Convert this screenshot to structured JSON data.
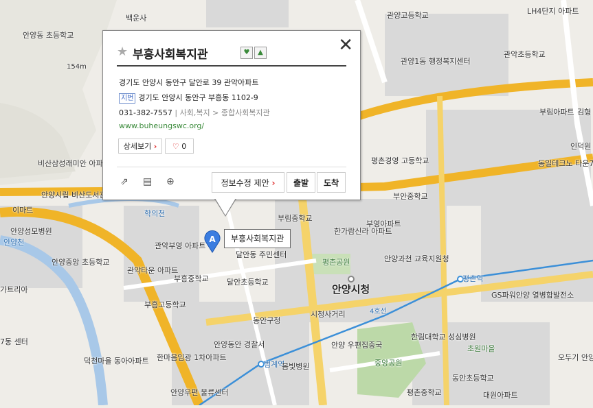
{
  "popup": {
    "title": "부흥사회복지관",
    "road_address": "경기도 안양시 동안구 달안로 39 관악아파트",
    "jibun_tag": "지번",
    "jibun_address": "경기도 안양시 동안구 부흥동 1102-9",
    "phone": "031-382-7557",
    "category": "사회,복지 > 종합사회복지관",
    "website": "www.buheungswc.org/",
    "detail_button": "상세보기",
    "like_count": "0",
    "edit_button": "정보수정 제안",
    "depart_button": "출발",
    "arrive_button": "도착"
  },
  "marker": {
    "letter": "A",
    "label": "부흥사회복지관"
  },
  "map_labels": [
    "백운사",
    "안양동 초등학교",
    "154m",
    "비산삼성래미안 아파트",
    "안양시립 비산도서관",
    "이마트",
    "안양성모병원",
    "학의천",
    "안양천",
    "관악부영 아파트",
    "관악타운 아파트",
    "부흥고등학교",
    "부흥중학교",
    "안양중앙 초등학교",
    "가트리아",
    "7동 센터",
    "달안동 주민센터",
    "달안초등학교",
    "부림중학교",
    "한가람신라 아파트",
    "부영아파트",
    "평촌공원",
    "안양과천 교육지원청",
    "안양시청",
    "동안구청",
    "시청사거리",
    "안양동안 경찰서",
    "한마음임광 1차아파트",
    "덕천마을 동아아파트",
    "범계역",
    "안양우편 물류센터",
    "안양 우편집중국",
    "봄빛병원",
    "중앙공원",
    "한림대학교 성심병원",
    "초원마을",
    "동안초등학교",
    "평촌중학교",
    "대원아파트",
    "평촌역",
    "GS파워안양 열병합발전소",
    "오두기 안양공장",
    "동일테크노 타운7차",
    "부안중학교",
    "평촌경영 고등학교",
    "부림아파트",
    "관악초등학교",
    "관양1동 행정복지센터",
    "관양고등학교",
    "LH4단지 아파트",
    "인덕원",
    "김형",
    "4호선"
  ],
  "colors": {
    "road_yellow": "#f5d36a",
    "road_orange": "#f0b428",
    "block": "#d6d6d6",
    "park": "#c9e0b8",
    "water": "#a8c8e8",
    "subway": "#3b8fd8",
    "marker": "#3b7de0"
  }
}
